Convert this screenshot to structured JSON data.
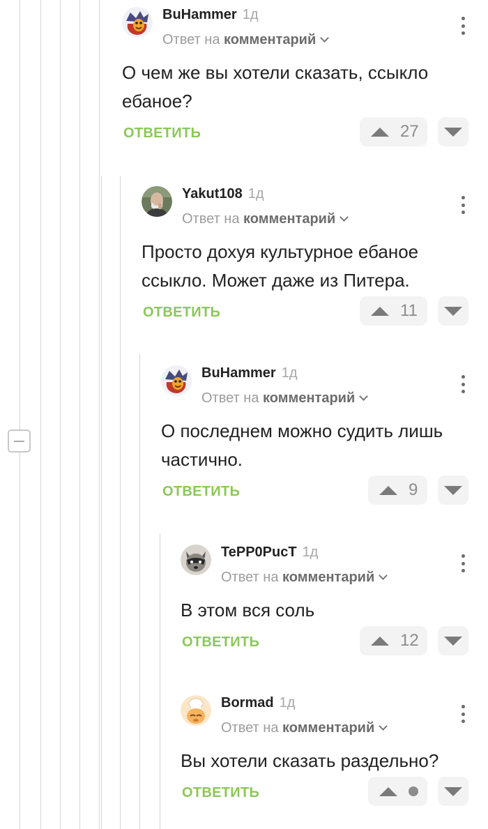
{
  "comments": [
    {
      "author": "BuHammer",
      "age": "1д",
      "reply_prefix": "Ответ на",
      "reply_link": "комментарий",
      "text": "О чем же вы хотели сказать, ссыкло ебаное?",
      "reply_label": "ОТВЕТИТЬ",
      "rating": "27",
      "avatar": "crowned-duck-avatar"
    },
    {
      "author": "Yakut108",
      "age": "1д",
      "reply_prefix": "Ответ на",
      "reply_link": "комментарий",
      "text": "Просто дохуя культурное ебаное ссыкло. Может даже из Питера.",
      "reply_label": "ОТВЕТИТЬ",
      "rating": "11",
      "avatar": "man-photo-avatar"
    },
    {
      "author": "BuHammer",
      "age": "1д",
      "reply_prefix": "Ответ на",
      "reply_link": "комментарий",
      "text": "О последнем можно судить лишь частично.",
      "reply_label": "ОТВЕТИТЬ",
      "rating": "9",
      "avatar": "crowned-duck-avatar"
    },
    {
      "author": "TePP0PucT",
      "age": "1д",
      "reply_prefix": "Ответ на",
      "reply_link": "комментарий",
      "text": "В этом вся соль",
      "reply_label": "ОТВЕТИТЬ",
      "rating": "12",
      "avatar": "raccoon-avatar"
    },
    {
      "author": "Bormad",
      "age": "1д",
      "reply_prefix": "Ответ на",
      "reply_link": "комментарий",
      "text": "Вы хотели сказать раздельно?",
      "reply_label": "ОТВЕТИТЬ",
      "rating": "",
      "avatar": "chef-avatar"
    }
  ],
  "colors": {
    "accent_green": "#8ac858",
    "thread_line": "#d5d5d5",
    "vote_bg": "#f3f3f3"
  },
  "icons": {
    "vote_up": "triangle-up-icon",
    "vote_down": "triangle-down-icon",
    "more": "vertical-dots-icon",
    "collapse": "minus-icon",
    "dropdown": "chevron-down-icon"
  }
}
